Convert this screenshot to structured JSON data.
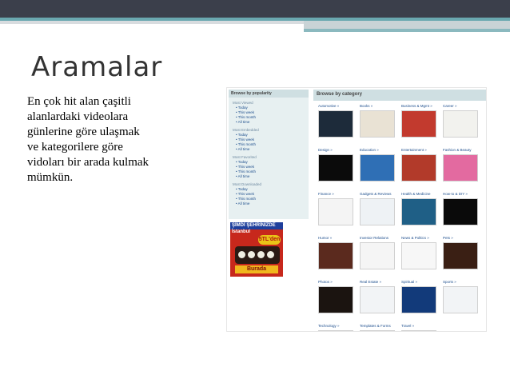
{
  "slide": {
    "title": "Aramalar",
    "body_lines": [
      "En çok hit alan çaşitli",
      "alanlardaki videolara",
      "günlerine göre ulaşmak",
      "ve kategorilere göre",
      "vidoları bir arada kulmak",
      "mümkün."
    ]
  },
  "screenshot": {
    "popular": {
      "header": "Browse by popularity",
      "groups": [
        {
          "title": "Most Viewed",
          "items": [
            "Today",
            "This week",
            "This month",
            "All time"
          ]
        },
        {
          "title": "Most Embedded",
          "items": [
            "Today",
            "This week",
            "This month",
            "All time"
          ]
        },
        {
          "title": "Most Favorited",
          "items": [
            "Today",
            "This week",
            "This month",
            "All time"
          ]
        },
        {
          "title": "Most Downloaded",
          "items": [
            "Today",
            "This week",
            "This month",
            "All time"
          ]
        }
      ]
    },
    "ad": {
      "line1": "ŞİMDİ ŞEHRİNİZDE",
      "line2": "İstanbul",
      "badge": "5TL'den",
      "bottom": "Burada"
    },
    "browse": {
      "header": "Browse by category",
      "categories": [
        {
          "label": "Automotive »",
          "color": "#1d2b3a"
        },
        {
          "label": "Books »",
          "color": "#e9e2d4"
        },
        {
          "label": "Business & Mgmt »",
          "color": "#c23a2e"
        },
        {
          "label": "Career »",
          "color": "#f2f2ee"
        },
        {
          "label": "Design »",
          "color": "#0b0b0b"
        },
        {
          "label": "Education »",
          "color": "#2f6fb5"
        },
        {
          "label": "Entertainment »",
          "color": "#b23a2a"
        },
        {
          "label": "Fashion & Beauty",
          "color": "#e36aa0"
        },
        {
          "label": "Finance »",
          "color": "#f4f4f4"
        },
        {
          "label": "Gadgets & Reviews",
          "color": "#eef2f5"
        },
        {
          "label": "Health & Medicine",
          "color": "#1f5f86"
        },
        {
          "label": "How-to & DIY »",
          "color": "#0a0a0a"
        },
        {
          "label": "Humor »",
          "color": "#5b2a1e"
        },
        {
          "label": "Investor Relations",
          "color": "#f5f5f5"
        },
        {
          "label": "News & Politics »",
          "color": "#f7f7f7"
        },
        {
          "label": "Pets »",
          "color": "#3a1f14"
        },
        {
          "label": "Photos »",
          "color": "#1b1410"
        },
        {
          "label": "Real Estate »",
          "color": "#f2f4f6"
        },
        {
          "label": "Spiritual »",
          "color": "#123a7a"
        },
        {
          "label": "Sports »",
          "color": "#f2f4f6"
        },
        {
          "label": "Technology »",
          "color": "#eef2f5"
        },
        {
          "label": "Templates & Forms",
          "color": "#eef2f5"
        },
        {
          "label": "Travel »",
          "color": "#eef2f5"
        }
      ]
    }
  }
}
